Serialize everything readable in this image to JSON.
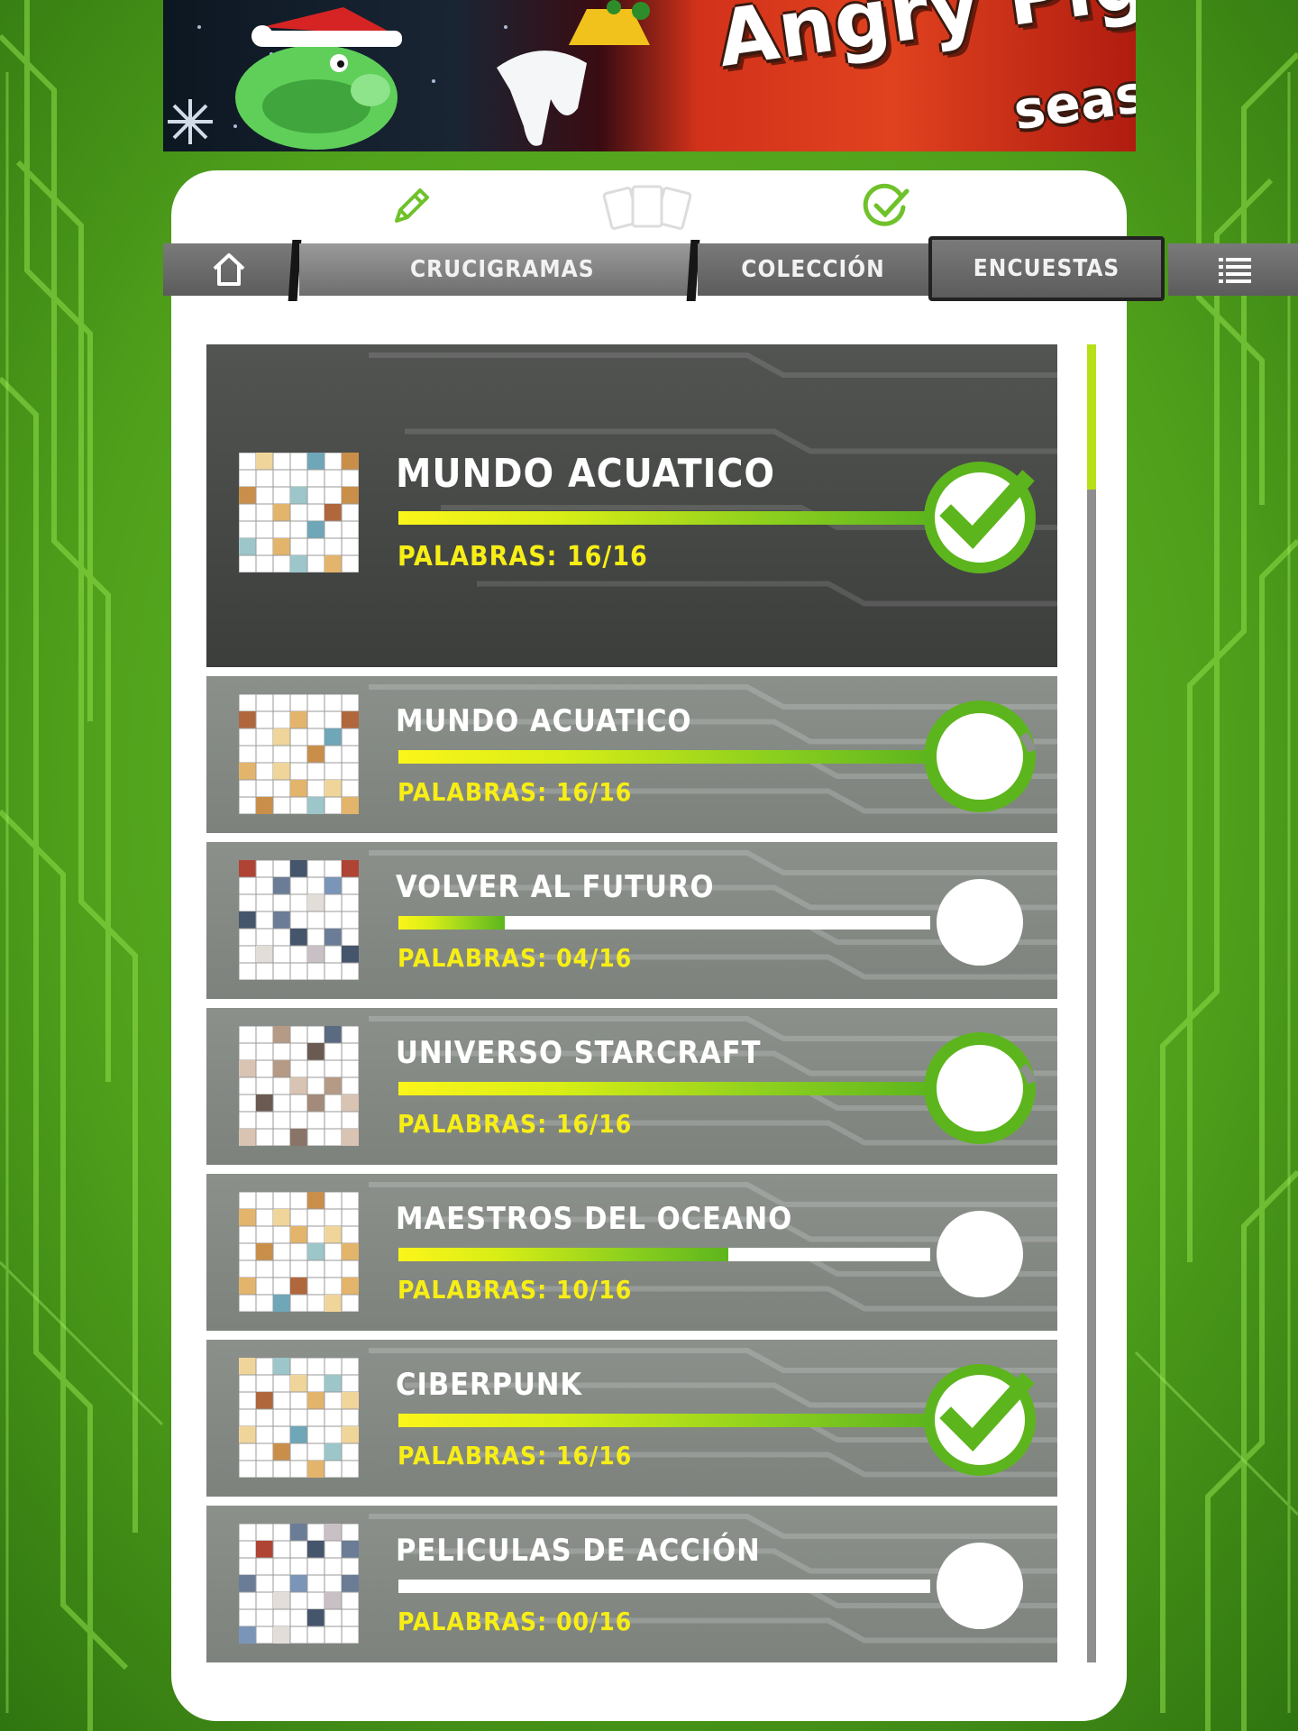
{
  "banner": {
    "title": "Angry Piggy",
    "subtitle": "season"
  },
  "top_icons": [
    "pencil-icon",
    "cards-icon",
    "check-circle-icon"
  ],
  "nav": {
    "home_icon": "home-icon",
    "tabs": [
      {
        "label": "CRUCIGRAMAS",
        "active": true
      },
      {
        "label": "COLECCIÓN",
        "active": false
      },
      {
        "label": "ENCUESTAS",
        "active": false
      }
    ],
    "menu_icon": "list-menu-icon"
  },
  "crosswords": [
    {
      "title": "MUNDO ACUATICO",
      "words": "PALABRAS: 16/16",
      "progress": 1.0,
      "status": "completed",
      "featured": true,
      "thumb": "ocean"
    },
    {
      "title": "MUNDO ACUATICO",
      "words": "PALABRAS: 16/16",
      "progress": 1.0,
      "status": "ring",
      "featured": false,
      "thumb": "ocean"
    },
    {
      "title": "VOLVER AL FUTURO",
      "words": "PALABRAS: 04/16",
      "progress": 0.2,
      "status": "empty",
      "featured": false,
      "thumb": "future"
    },
    {
      "title": "UNIVERSO STARCRAFT",
      "words": "PALABRAS: 16/16",
      "progress": 1.0,
      "status": "ring",
      "featured": false,
      "thumb": "starcraft"
    },
    {
      "title": "MAESTROS DEL OCEANO",
      "words": "PALABRAS: 10/16",
      "progress": 0.62,
      "status": "empty",
      "featured": false,
      "thumb": "ocean"
    },
    {
      "title": "CIBERPUNK",
      "words": "PALABRAS: 16/16",
      "progress": 1.0,
      "status": "completed",
      "featured": false,
      "thumb": "ocean"
    },
    {
      "title": "PELICULAS DE ACCIÓN",
      "words": "PALABRAS: 00/16",
      "progress": 0.0,
      "status": "empty",
      "featured": false,
      "thumb": "future"
    }
  ],
  "scroll": {
    "position": 0.0,
    "visible_fraction": 0.11
  },
  "colors": {
    "accent_green": "#5db51d",
    "accent_yellow": "#f7ee16",
    "lime": "#b7e016"
  }
}
